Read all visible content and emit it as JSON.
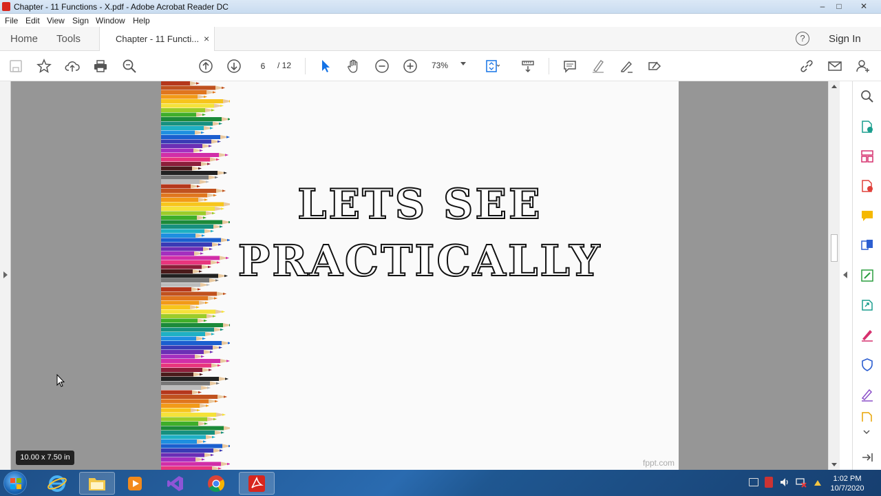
{
  "window": {
    "title": "Chapter - 11 Functions - X.pdf - Adobe Acrobat Reader DC",
    "minimize": "–",
    "maximize": "□",
    "close": "✕"
  },
  "menu": [
    "File",
    "Edit",
    "View",
    "Sign",
    "Window",
    "Help"
  ],
  "tabs": {
    "home": "Home",
    "tools": "Tools",
    "document": "Chapter - 11 Functi...",
    "close": "×"
  },
  "header_right": {
    "help": "?",
    "sign_in": "Sign In"
  },
  "toolbar": {
    "current_page": "6",
    "total_pages": "/ 12",
    "zoom": "73%"
  },
  "page": {
    "line1": "LETS SEE",
    "line2": "PRACTICALLY",
    "watermark": "fppt.com",
    "page_size": "10.00 x 7.50 in"
  },
  "taskbar": {
    "time": "1:02 PM",
    "date": "10/7/2020"
  },
  "colors": {
    "accent": "#1473e6",
    "pdf_red": "#d7261e",
    "taskbar": "#1e4f87"
  },
  "right_tools": [
    "search-icon",
    "export-pdf-icon",
    "organize-pages-icon",
    "create-pdf-icon",
    "comment-icon",
    "combine-files-icon",
    "edit-pdf-icon",
    "send-icon",
    "fill-sign-icon",
    "protect-icon",
    "sign-icon",
    "more-tools-icon"
  ]
}
